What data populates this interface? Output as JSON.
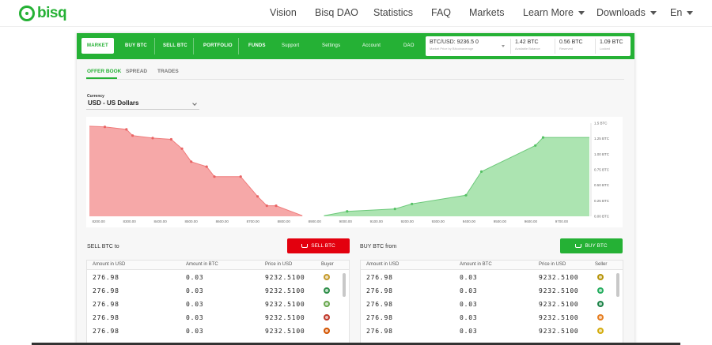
{
  "site": {
    "logo_text": "bisq",
    "nav": [
      {
        "label": "Vision",
        "dropdown": false
      },
      {
        "label": "Bisq DAO",
        "dropdown": false
      },
      {
        "label": "Statistics",
        "dropdown": false
      },
      {
        "label": "FAQ",
        "dropdown": false
      },
      {
        "label": "Markets",
        "dropdown": false
      },
      {
        "label": "Learn More",
        "dropdown": true
      },
      {
        "label": "Downloads",
        "dropdown": true
      },
      {
        "label": "En",
        "dropdown": true
      }
    ]
  },
  "app": {
    "tabs": [
      {
        "label": "MARKET",
        "active": true
      },
      {
        "label": "BUY BTC"
      },
      {
        "label": "SELL BTC"
      },
      {
        "label": "PORTFOLIO"
      },
      {
        "label": "FUNDS"
      }
    ],
    "secondary_tabs": [
      "Support",
      "Settings",
      "Account",
      "DAO"
    ],
    "price": {
      "value": "BTC/USD: 9236.5 0",
      "sub": "Market Price by Bitcoinaverage"
    },
    "balances": [
      {
        "value": "1.42 BTC",
        "label": "Available Balance"
      },
      {
        "value": "0.56 BTC",
        "label": "Reserved"
      },
      {
        "value": "1.09 BTC",
        "label": "Locked"
      }
    ],
    "subtabs": [
      {
        "label": "OFFER BOOK",
        "active": true
      },
      {
        "label": "SPREAD"
      },
      {
        "label": "TRADES"
      }
    ],
    "currency": {
      "label": "Currency",
      "value": "USD - US Dollars"
    }
  },
  "chart_data": {
    "type": "area",
    "x_ticks": [
      "8200.00",
      "8300.00",
      "8400.00",
      "8500.00",
      "8600.00",
      "8700.00",
      "8800.00",
      "8900.00",
      "9000.00",
      "9100.00",
      "9200.00",
      "9300.00",
      "9400.00",
      "9500.00",
      "9600.00",
      "9700.00"
    ],
    "y_ticks": [
      "0.00 BTC",
      "0.25 BTC",
      "0.50 BTC",
      "0.75 BTC",
      "1.00 BTC",
      "1.25 BTC",
      "1.5 BTC"
    ],
    "ylim": [
      0,
      1.5
    ],
    "xlim": [
      8170,
      9790
    ],
    "series": [
      {
        "color": "#f5a3a3",
        "points": [
          [
            8170,
            1.45
          ],
          [
            8220,
            1.44
          ],
          [
            8290,
            1.4
          ],
          [
            8310,
            1.3
          ],
          [
            8375,
            1.26
          ],
          [
            8435,
            1.24
          ],
          [
            8470,
            1.09
          ],
          [
            8500,
            0.88
          ],
          [
            8550,
            0.8
          ],
          [
            8575,
            0.64
          ],
          [
            8660,
            0.64
          ],
          [
            8715,
            0.32
          ],
          [
            8745,
            0.17
          ],
          [
            8775,
            0.17
          ],
          [
            8860,
            0.01
          ]
        ]
      },
      {
        "color": "#a8e3ad",
        "points": [
          [
            8930,
            0.01
          ],
          [
            9005,
            0.08
          ],
          [
            9160,
            0.12
          ],
          [
            9215,
            0.2
          ],
          [
            9390,
            0.34
          ],
          [
            9440,
            0.72
          ],
          [
            9615,
            1.14
          ],
          [
            9640,
            1.27
          ],
          [
            9790,
            1.27
          ]
        ]
      }
    ]
  },
  "sell_panel": {
    "title": "SELL BTC to",
    "button": "SELL BTC",
    "columns": [
      "Amount in USD",
      "Amount in BTC",
      "Price in USD",
      "Buyer"
    ],
    "rows": [
      {
        "usd": "276.98",
        "btc": "0.03",
        "price": "9232.5100",
        "avatar": "#c59a2b"
      },
      {
        "usd": "276.98",
        "btc": "0.03",
        "price": "9232.5100",
        "avatar": "#2f8f4a"
      },
      {
        "usd": "276.98",
        "btc": "0.03",
        "price": "9232.5100",
        "avatar": "#6aa84f"
      },
      {
        "usd": "276.98",
        "btc": "0.03",
        "price": "9232.5100",
        "avatar": "#c0392b"
      },
      {
        "usd": "276.98",
        "btc": "0.03",
        "price": "9232.5100",
        "avatar": "#d35400"
      }
    ]
  },
  "buy_panel": {
    "title": "BUY BTC from",
    "button": "BUY BTC",
    "columns": [
      "Amount in USD",
      "Amount in BTC",
      "Price in USD",
      "Seller"
    ],
    "rows": [
      {
        "usd": "276.98",
        "btc": "0.03",
        "price": "9232.5100",
        "avatar": "#b7950b"
      },
      {
        "usd": "276.98",
        "btc": "0.03",
        "price": "9232.5100",
        "avatar": "#27ae60"
      },
      {
        "usd": "276.98",
        "btc": "0.03",
        "price": "9232.5100",
        "avatar": "#1e8449"
      },
      {
        "usd": "276.98",
        "btc": "0.03",
        "price": "9232.5100",
        "avatar": "#e67e22"
      },
      {
        "usd": "276.98",
        "btc": "0.03",
        "price": "9232.5100",
        "avatar": "#d4ac0d"
      }
    ]
  }
}
